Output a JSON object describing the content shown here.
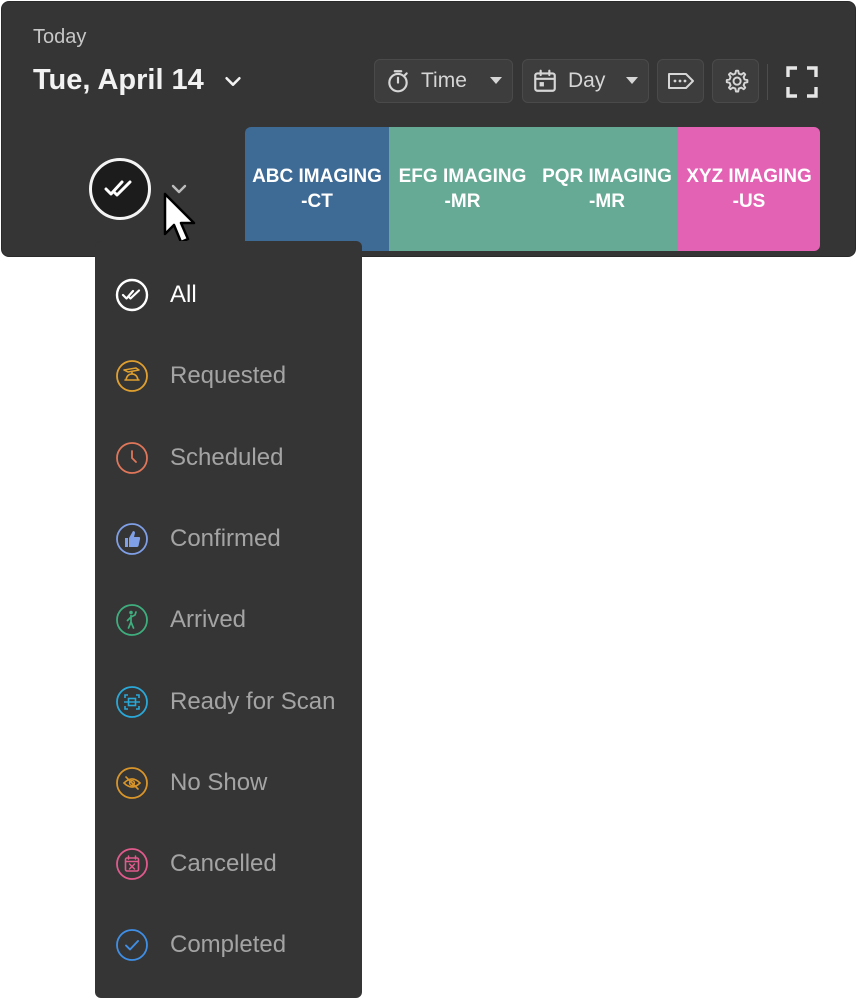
{
  "header": {
    "today_label": "Today",
    "date": "Tue, April 14"
  },
  "toolbar": {
    "time_label": "Time",
    "day_label": "Day"
  },
  "resources": [
    {
      "label": "ABC IMAGING\n-CT",
      "color": "#3e6a96"
    },
    {
      "label": "EFG IMAGING\n-MR",
      "color": "#66aa96"
    },
    {
      "label": "PQR IMAGING\n-MR",
      "color": "#66aa96"
    },
    {
      "label": "XYZ IMAGING\n-US",
      "color": "#e462b4"
    }
  ],
  "status_menu": {
    "items": [
      {
        "label": "All",
        "icon": "double-check-icon",
        "color": "#ffffff",
        "active": true
      },
      {
        "label": "Requested",
        "icon": "bell-hand-icon",
        "color": "#e0a030"
      },
      {
        "label": "Scheduled",
        "icon": "clock-icon",
        "color": "#e0765a"
      },
      {
        "label": "Confirmed",
        "icon": "thumbs-up-icon",
        "color": "#7f9fe6"
      },
      {
        "label": "Arrived",
        "icon": "person-arrived-icon",
        "color": "#3fae7e"
      },
      {
        "label": "Ready for Scan",
        "icon": "scan-icon",
        "color": "#2aa8d8"
      },
      {
        "label": "No Show",
        "icon": "eye-off-icon",
        "color": "#d9952a"
      },
      {
        "label": "Cancelled",
        "icon": "calendar-x-icon",
        "color": "#e05a8c"
      },
      {
        "label": "Completed",
        "icon": "check-circle-icon",
        "color": "#3f8fe6"
      }
    ]
  }
}
